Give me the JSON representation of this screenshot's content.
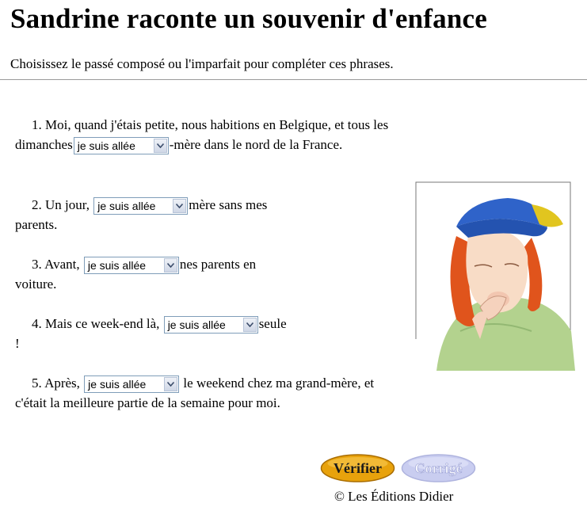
{
  "page": {
    "title": "Sandrine raconte un souvenir d'enfance",
    "instruction": "Choisissez le passé composé ou l'imparfait pour compléter ces phrases."
  },
  "exercises": [
    {
      "number": "1.",
      "before": "Moi, quand j'étais petite, nous habitions en Belgique, et tous les dimanches",
      "select_value": "je suis allée",
      "after": "-mère dans le nord de la France."
    },
    {
      "number": "2.",
      "before": "Un jour,",
      "select_value": "je suis allée",
      "after": "mère sans mes parents."
    },
    {
      "number": "3.",
      "before": "Avant,",
      "select_value": "je suis allée",
      "after": "nes parents en voiture."
    },
    {
      "number": "4.",
      "before": "Mais ce week-end là,",
      "select_value": "je suis allée",
      "after": "seule !"
    },
    {
      "number": "5.",
      "before": "Après,",
      "select_value": "je suis allée",
      "after": "le weekend chez ma grand-mère, et c'était la meilleure partie de la semaine pour moi."
    }
  ],
  "buttons": {
    "verify": "Vérifier",
    "corrige": "Corrigé"
  },
  "footer": {
    "copyright": "© Les Éditions Didier"
  },
  "colors": {
    "verify_gold": "#e8a20c",
    "corrige_lavender": "#c9cdf0",
    "cap_blue": "#2f63c9",
    "hair_orange": "#e0541c",
    "shirt_green": "#b3d28e"
  },
  "icons": {
    "select_arrow": "chevron-down-icon"
  }
}
